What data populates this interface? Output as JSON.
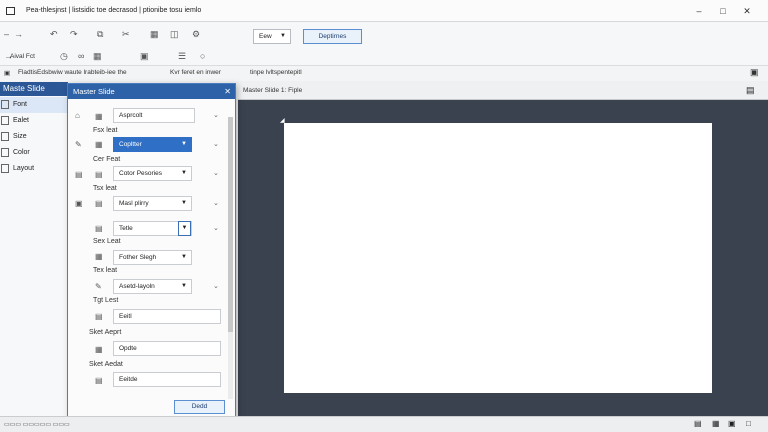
{
  "window": {
    "title": "Pea-thlesjnst | listsidic toe decrasod | ptionibe tosu iemlo",
    "min_icon": "minimize-icon",
    "max_icon": "maximize-icon",
    "close_icon": "close-icon"
  },
  "toolbar": {
    "dropdown_value": "Eew",
    "button_label": "Deptirnes"
  },
  "fontrow": {
    "font_name": "Aival Fct"
  },
  "addressbar": {
    "text1": "Fladtis",
    "text2": "Edsbwiw waute lrabteib-iee the",
    "text3": "Kvr feret en inwer",
    "text4": "tinpe lvltspentepitl"
  },
  "sidebar": {
    "header": "Maste Slide",
    "items": [
      {
        "label": "Font"
      },
      {
        "label": "Ealet"
      },
      {
        "label": "Size"
      },
      {
        "label": "Color"
      },
      {
        "label": "Layout"
      }
    ]
  },
  "canvas": {
    "header_label": "Master Slide 1: Fiple"
  },
  "dialog": {
    "title": "Master Slide",
    "rows": [
      {
        "label": "",
        "value": "Asprcolt"
      },
      {
        "label": "Fsx leat",
        "value": "Copltter"
      },
      {
        "label": "Cer Feat",
        "value": "Cotor Pesories"
      },
      {
        "label": "Tsx leat",
        "value": "Masl plirry"
      },
      {
        "label": "",
        "value": "Tetle"
      },
      {
        "label": "Sex Leat",
        "value": "Fother Slegh"
      },
      {
        "label": "Tex leat",
        "value": "Asetd-layoln"
      },
      {
        "label": "Tgt Lest",
        "value": "Eeitl"
      },
      {
        "label": "Sket Aeprt",
        "value": "Opdte"
      },
      {
        "label": "Sket Aedat",
        "value": "Eeitde"
      }
    ],
    "ok_button": "Dedd"
  }
}
